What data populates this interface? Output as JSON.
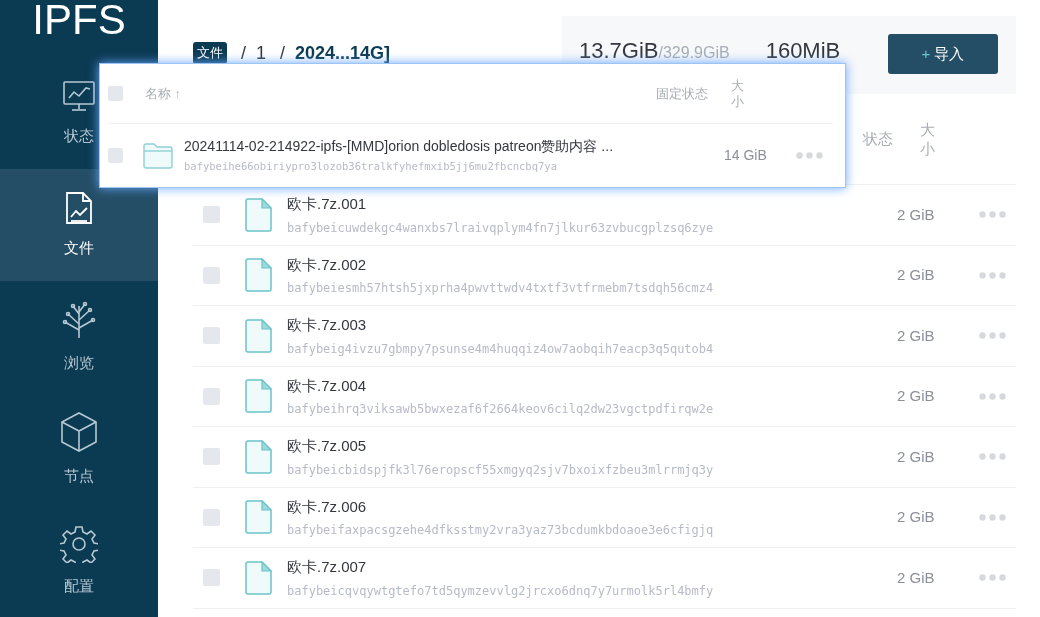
{
  "sidebar": {
    "logo": "IPFS",
    "items": [
      {
        "label": "状态",
        "kind": "status",
        "selected": false
      },
      {
        "label": "文件",
        "kind": "files",
        "selected": true
      },
      {
        "label": "浏览",
        "kind": "explore",
        "selected": false
      },
      {
        "label": "节点",
        "kind": "peers",
        "selected": false
      },
      {
        "label": "配置",
        "kind": "settings",
        "selected": false
      }
    ]
  },
  "breadcrumb": [
    {
      "label": "文件",
      "kind": "root"
    },
    {
      "label": "/",
      "kind": "separator"
    },
    {
      "label": "1",
      "kind": "folder"
    },
    {
      "label": "/",
      "kind": "separator"
    },
    {
      "label": "2024...14G]",
      "kind": "current"
    }
  ],
  "stats": [
    {
      "value": "13.7GiB",
      "total": "/329.9GiB"
    },
    {
      "value": "160MiB"
    }
  ],
  "import_button": {
    "icon": "+",
    "label": "导入"
  },
  "table": {
    "columns": [
      "状态",
      "大小"
    ],
    "rows": [
      {
        "name": "欧卡.7z.001",
        "cid": "bafybeicuwdekgc4wanxbs7lraivqplym4fn7jlkur63zvbucgplzsq6zye",
        "size": "2 GiB",
        "checked": false
      },
      {
        "name": "欧卡.7z.002",
        "cid": "bafybeiesmh57htsh5jxprha4pwvttwdv4txtf3vtfrmebm7tsdqh56cmz4",
        "size": "2 GiB",
        "checked": false
      },
      {
        "name": "欧卡.7z.003",
        "cid": "bafybeig4ivzu7gbmpy7psunse4m4huqqiz4ow7aobqih7eacp3q5qutob4",
        "size": "2 GiB",
        "checked": false
      },
      {
        "name": "欧卡.7z.004",
        "cid": "bafybeihrq3viksawb5bwxezaf6f2664keov6cilq2dw23vgctpdfirqw2e",
        "size": "2 GiB",
        "checked": false
      },
      {
        "name": "欧卡.7z.005",
        "cid": "bafybeicbidspjfk3l76eropscf55xmgyq2sjv7bxoixfzbeu3mlrrmjq3y",
        "size": "2 GiB",
        "checked": false
      },
      {
        "name": "欧卡.7z.006",
        "cid": "bafybeifaxpacsgzehe4dfksstmy2vra3yaz73bcdumkbdoaoe3e6cfigjq",
        "size": "2 GiB",
        "checked": false
      },
      {
        "name": "欧卡.7z.007",
        "cid": "bafybeicqvqywtgtefo7td5qymzevvlg2jrcxo6dnq7y7urmolk5rl4bmfy",
        "size": "2 GiB",
        "checked": false
      }
    ]
  },
  "drag_preview": {
    "header": {
      "checked": false,
      "name": "名称",
      "sort": "↑",
      "pin": "固定状态",
      "size": "大小"
    },
    "item": {
      "kind": "folder",
      "name": "20241114-02-214922-ipfs-[MMD]orion dobledosis patreon赞助内容 ...",
      "cid": "bafybeihe66obiriypro3lozob36tralkfyhefmxib5jj6mu2fbcncbq7ya",
      "size": "14 GiB",
      "checked": false
    }
  }
}
